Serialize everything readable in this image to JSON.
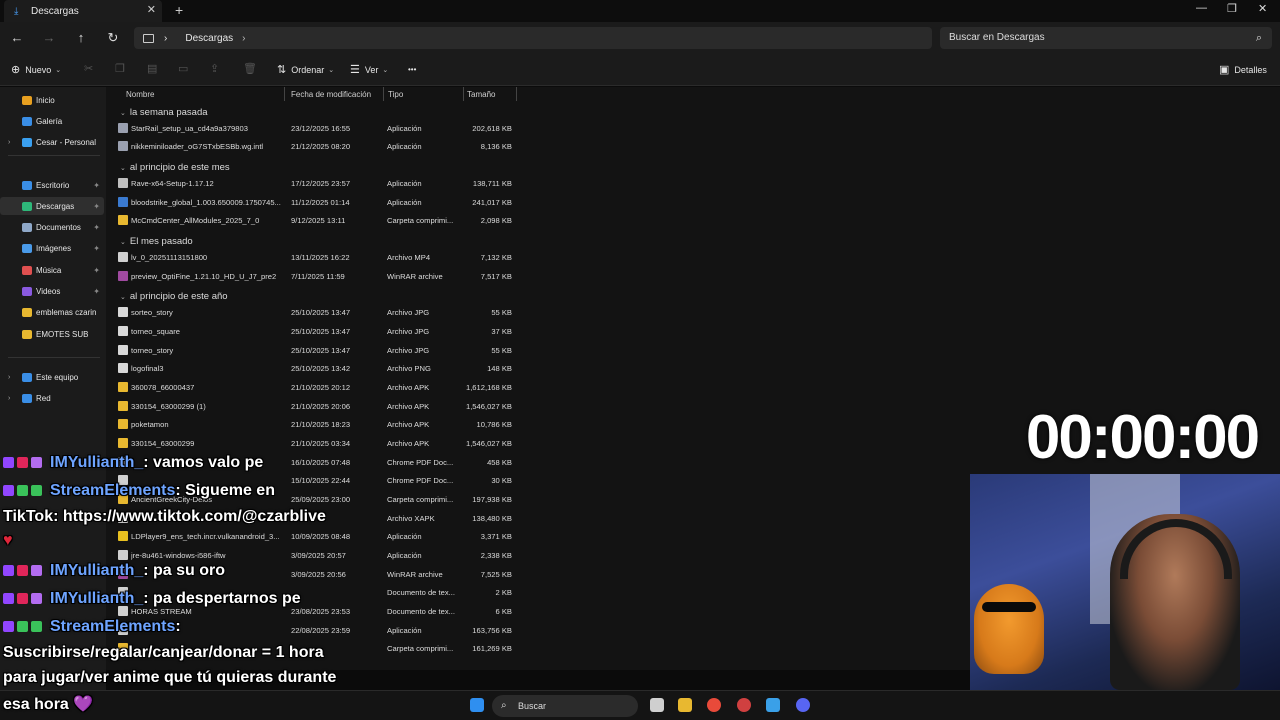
{
  "window": {
    "tab_title": "Descargas",
    "close_tab": "✕",
    "new_tab": "+",
    "minimize": "—",
    "maximize": "❐",
    "close": "✕"
  },
  "nav": {
    "back": "←",
    "forward": "→",
    "up": "↑",
    "refresh": "↻",
    "breadcrumb": "Descargas",
    "chevron": "›",
    "search_placeholder": "Buscar en Descargas",
    "search_icon": "⌕"
  },
  "toolbar": {
    "new_label": "Nuevo",
    "sort_label": "Ordenar",
    "view_label": "Ver",
    "more_label": "•••",
    "details_label": "Detalles"
  },
  "sidebar": {
    "items": [
      {
        "label": "Inicio",
        "icon": "home-icon",
        "color": "#e8a020"
      },
      {
        "label": "Galería",
        "icon": "gallery-icon",
        "color": "#3a8ee6"
      },
      {
        "label": "Cesar - Personal",
        "icon": "cloud-icon",
        "color": "#3aa0f0"
      },
      {
        "label": "Escritorio",
        "icon": "desktop-icon",
        "color": "#3a8ee6"
      },
      {
        "label": "Descargas",
        "icon": "download-icon",
        "color": "#2eb87a"
      },
      {
        "label": "Documentos",
        "icon": "documents-icon",
        "color": "#8fa8c8"
      },
      {
        "label": "Imágenes",
        "icon": "images-icon",
        "color": "#4a9ae8"
      },
      {
        "label": "Música",
        "icon": "music-icon",
        "color": "#e05050"
      },
      {
        "label": "Videos",
        "icon": "videos-icon",
        "color": "#8a5ae0"
      },
      {
        "label": "emblemas czarin",
        "icon": "folder-icon",
        "color": "#e8b830"
      },
      {
        "label": "EMOTES SUB",
        "icon": "folder-icon",
        "color": "#e8b830"
      },
      {
        "label": "Este equipo",
        "icon": "pc-icon",
        "color": "#3a8ee6"
      },
      {
        "label": "Red",
        "icon": "network-icon",
        "color": "#3a8ee6"
      }
    ]
  },
  "columns": {
    "name": "Nombre",
    "modified": "Fecha de modificación",
    "type": "Tipo",
    "size": "Tamaño"
  },
  "groups": [
    {
      "label": "la semana pasada",
      "files": [
        {
          "name": "StarRail_setup_ua_cd4a9a379803",
          "date": "23/12/2025 16:55",
          "type": "Aplicación",
          "size": "202,618 KB",
          "color": "#9aa0b0"
        },
        {
          "name": "nikkeminiloader_oG7STxbESBb.wg.intl",
          "date": "21/12/2025 08:20",
          "type": "Aplicación",
          "size": "8,136 KB",
          "color": "#9aa0b0"
        }
      ]
    },
    {
      "label": "al principio de este mes",
      "files": [
        {
          "name": "Rave-x64-Setup-1.17.12",
          "date": "17/12/2025 23:57",
          "type": "Aplicación",
          "size": "138,711 KB",
          "color": "#c0c0c0"
        },
        {
          "name": "bloodstrike_global_1.003.650009.1750745...",
          "date": "11/12/2025 01:14",
          "type": "Aplicación",
          "size": "241,017 KB",
          "color": "#3a7ad0"
        },
        {
          "name": "McCmdCenter_AllModules_2025_7_0",
          "date": "9/12/2025 13:11",
          "type": "Carpeta comprimi...",
          "size": "2,098 KB",
          "color": "#e8b830"
        }
      ]
    },
    {
      "label": "El mes pasado",
      "files": [
        {
          "name": "lv_0_20251113151800",
          "date": "13/11/2025 16:22",
          "type": "Archivo MP4",
          "size": "7,132 KB",
          "color": "#d0d0d0"
        },
        {
          "name": "preview_OptiFine_1.21.10_HD_U_J7_pre2",
          "date": "7/11/2025 11:59",
          "type": "WinRAR archive",
          "size": "7,517 KB",
          "color": "#a04aa0"
        }
      ]
    },
    {
      "label": "al principio de este año",
      "files": [
        {
          "name": "sorteo_story",
          "date": "25/10/2025 13:47",
          "type": "Archivo JPG",
          "size": "55 KB",
          "color": "#d8d8d8"
        },
        {
          "name": "torneo_square",
          "date": "25/10/2025 13:47",
          "type": "Archivo JPG",
          "size": "37 KB",
          "color": "#d8d8d8"
        },
        {
          "name": "torneo_story",
          "date": "25/10/2025 13:47",
          "type": "Archivo JPG",
          "size": "55 KB",
          "color": "#d8d8d8"
        },
        {
          "name": "logofinal3",
          "date": "25/10/2025 13:42",
          "type": "Archivo PNG",
          "size": "148 KB",
          "color": "#d8d8d8"
        },
        {
          "name": "360078_66000437",
          "date": "21/10/2025 20:12",
          "type": "Archivo APK",
          "size": "1,612,168 KB",
          "color": "#e8b830"
        },
        {
          "name": "330154_63000299 (1)",
          "date": "21/10/2025 20:06",
          "type": "Archivo APK",
          "size": "1,546,027 KB",
          "color": "#e8b830"
        },
        {
          "name": "poketamon",
          "date": "21/10/2025 18:23",
          "type": "Archivo APK",
          "size": "10,786 KB",
          "color": "#e8b830"
        },
        {
          "name": "330154_63000299",
          "date": "21/10/2025 03:34",
          "type": "Archivo APK",
          "size": "1,546,027 KB",
          "color": "#e8b830"
        },
        {
          "name": "",
          "date": "16/10/2025 07:48",
          "type": "Chrome PDF Doc...",
          "size": "458 KB",
          "color": "#d0d0d0"
        },
        {
          "name": "",
          "date": "15/10/2025 22:44",
          "type": "Chrome PDF Doc...",
          "size": "30 KB",
          "color": "#d0d0d0"
        },
        {
          "name": "AncientGreekCity-Delos",
          "date": "25/09/2025 23:00",
          "type": "Carpeta comprimi...",
          "size": "197,938 KB",
          "color": "#e8b830"
        },
        {
          "name": "",
          "date": "",
          "type": "Archivo XAPK",
          "size": "138,480 KB",
          "color": "#d0d0d0"
        },
        {
          "name": "LDPlayer9_ens_tech.incr.vulkanandroid_3...",
          "date": "10/09/2025 08:48",
          "type": "Aplicación",
          "size": "3,371 KB",
          "color": "#e8c020"
        },
        {
          "name": "jre-8u461-windows-i586-iftw",
          "date": "3/09/2025 20:57",
          "type": "Aplicación",
          "size": "2,338 KB",
          "color": "#d0d0d0"
        },
        {
          "name": "",
          "date": "3/09/2025 20:56",
          "type": "WinRAR archive",
          "size": "7,525 KB",
          "color": "#a04aa0"
        },
        {
          "name": "",
          "date": "",
          "type": "Documento de tex...",
          "size": "2 KB",
          "color": "#d0d0d0"
        },
        {
          "name": "HORAS STREAM",
          "date": "23/08/2025 23:53",
          "type": "Documento de tex...",
          "size": "6 KB",
          "color": "#d0d0d0"
        },
        {
          "name": "",
          "date": "22/08/2025 23:59",
          "type": "Aplicación",
          "size": "163,756 KB",
          "color": "#d0d0d0"
        },
        {
          "name": "",
          "date": "",
          "type": "Carpeta comprimi...",
          "size": "161,269 KB",
          "color": "#e8b830"
        }
      ]
    }
  ],
  "taskbar": {
    "search_label": "Buscar",
    "icons": [
      {
        "name": "windows-start-icon",
        "color": "#2f8ff0"
      },
      {
        "name": "task-view-icon",
        "color": "#cfcfcf"
      },
      {
        "name": "file-explorer-icon",
        "color": "#e8b830"
      },
      {
        "name": "chrome-icon",
        "color": "#e84a3a"
      },
      {
        "name": "app-icon",
        "color": "#d04040"
      },
      {
        "name": "notepad-icon",
        "color": "#3aa0e8"
      },
      {
        "name": "discord-icon",
        "color": "#5865f2"
      }
    ]
  },
  "overlay": {
    "timer": "00:00:00",
    "chat": [
      {
        "user": "IMYulliaпth_",
        "text": ": vamos valo pe"
      },
      {
        "user": "StreamElements",
        "text": ": Sigueme en"
      },
      {
        "text": "TikTok: https://www.tiktok.com/@czarblive"
      },
      {
        "text": "♥"
      },
      {
        "user": "IMYulliaпth_",
        "text": ": pa su oro"
      },
      {
        "user": "IMYulliaпth_",
        "text": ": pa despertarnos pe"
      },
      {
        "user": "StreamElements",
        "text": ":"
      },
      {
        "text": "Suscribirse/regalar/canjear/donar = 1 hora"
      },
      {
        "text": "para jugar/ver anime que tú quieras durante"
      },
      {
        "text": "esa hora 💜"
      }
    ],
    "badge_colors": [
      "#9146ff",
      "#e0265a",
      "#b36cf0",
      "#3ac25a"
    ]
  }
}
